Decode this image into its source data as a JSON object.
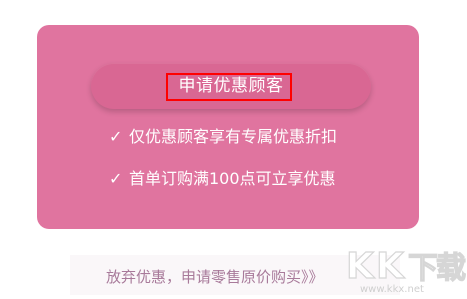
{
  "offer_card": {
    "apply_button_label": "申请优惠顾客",
    "benefits": [
      {
        "icon": "check-icon",
        "text": "仅优惠顾客享有专属优惠折扣"
      },
      {
        "icon": "check-icon",
        "text": "首单订购满100点可立享优惠"
      }
    ]
  },
  "decline_link_label": "放弃优惠，申请零售原价购买》》",
  "watermark": {
    "logo_text": "KK下载",
    "url": "www.kkx.net"
  },
  "colors": {
    "card_background": "#e0749f",
    "button_background": "#d96793",
    "highlight_border": "#ff0000",
    "decline_text": "#a87a9a"
  }
}
